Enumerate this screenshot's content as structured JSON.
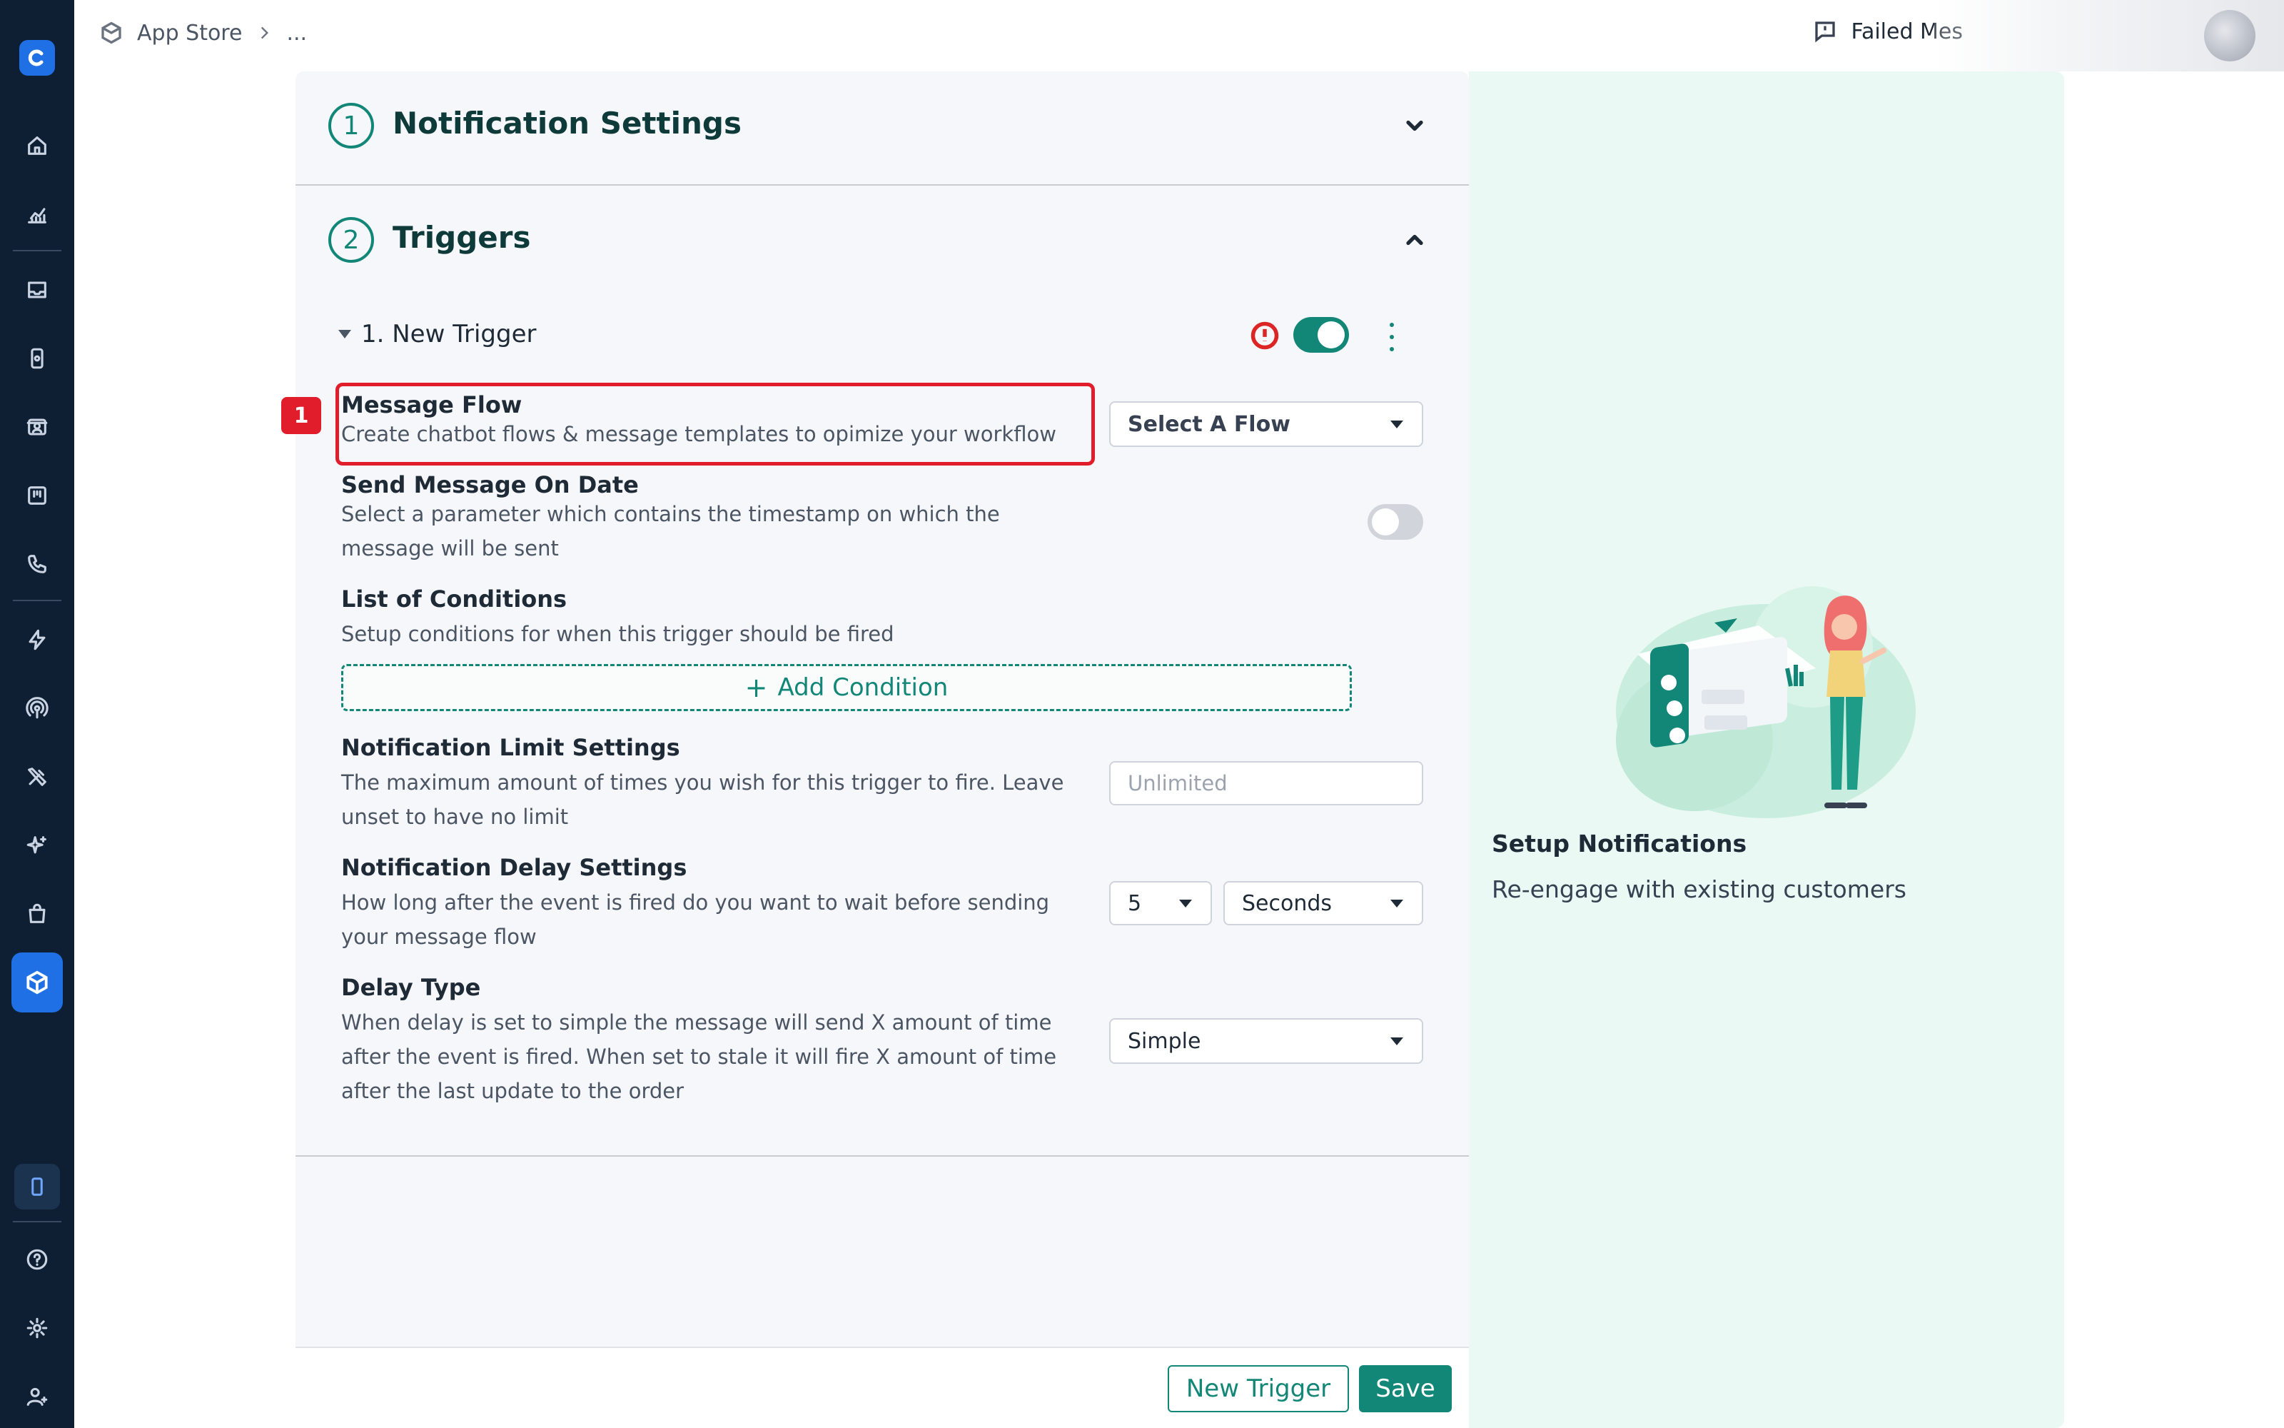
{
  "breadcrumb": {
    "app": "App Store",
    "more": "..."
  },
  "header": {
    "failed_messages": "Failed Mes"
  },
  "sections": {
    "notification_settings": {
      "number": "1",
      "title": "Notification Settings"
    },
    "triggers": {
      "number": "2",
      "title": "Triggers"
    }
  },
  "trigger": {
    "name": "1. New Trigger"
  },
  "fields": {
    "message_flow": {
      "title": "Message Flow",
      "desc": "Create chatbot flows & message templates to opimize your workflow",
      "select": "Select A Flow"
    },
    "send_on_date": {
      "title": "Send Message On Date",
      "desc": "Select a parameter which contains the timestamp on which the message will be sent"
    },
    "conditions": {
      "title": "List of Conditions",
      "desc": "Setup conditions for when this trigger should be fired",
      "add": "Add Condition"
    },
    "limit": {
      "title": "Notification Limit Settings",
      "desc": "The maximum amount of times you wish for this trigger to fire. Leave unset to have no limit",
      "placeholder": "Unlimited"
    },
    "delay": {
      "title": "Notification Delay Settings",
      "desc": "How long after the event is fired do you want to wait before sending your message flow",
      "amount": "5",
      "unit": "Seconds"
    },
    "delay_type": {
      "title": "Delay Type",
      "desc": "When delay is set to simple the message will send X amount of time after the event is fired. When set to stale it will fire X amount of time after the last update to the order",
      "value": "Simple"
    }
  },
  "annotation": {
    "badge": "1"
  },
  "footer": {
    "new_trigger": "New Trigger",
    "save": "Save"
  },
  "info": {
    "title": "Setup Notifications",
    "subtitle": "Re-engage with existing customers"
  },
  "colors": {
    "accent": "#128777",
    "sidebar": "#0e1e33",
    "highlight": "#e11d2b",
    "active": "#1f6fe5"
  }
}
